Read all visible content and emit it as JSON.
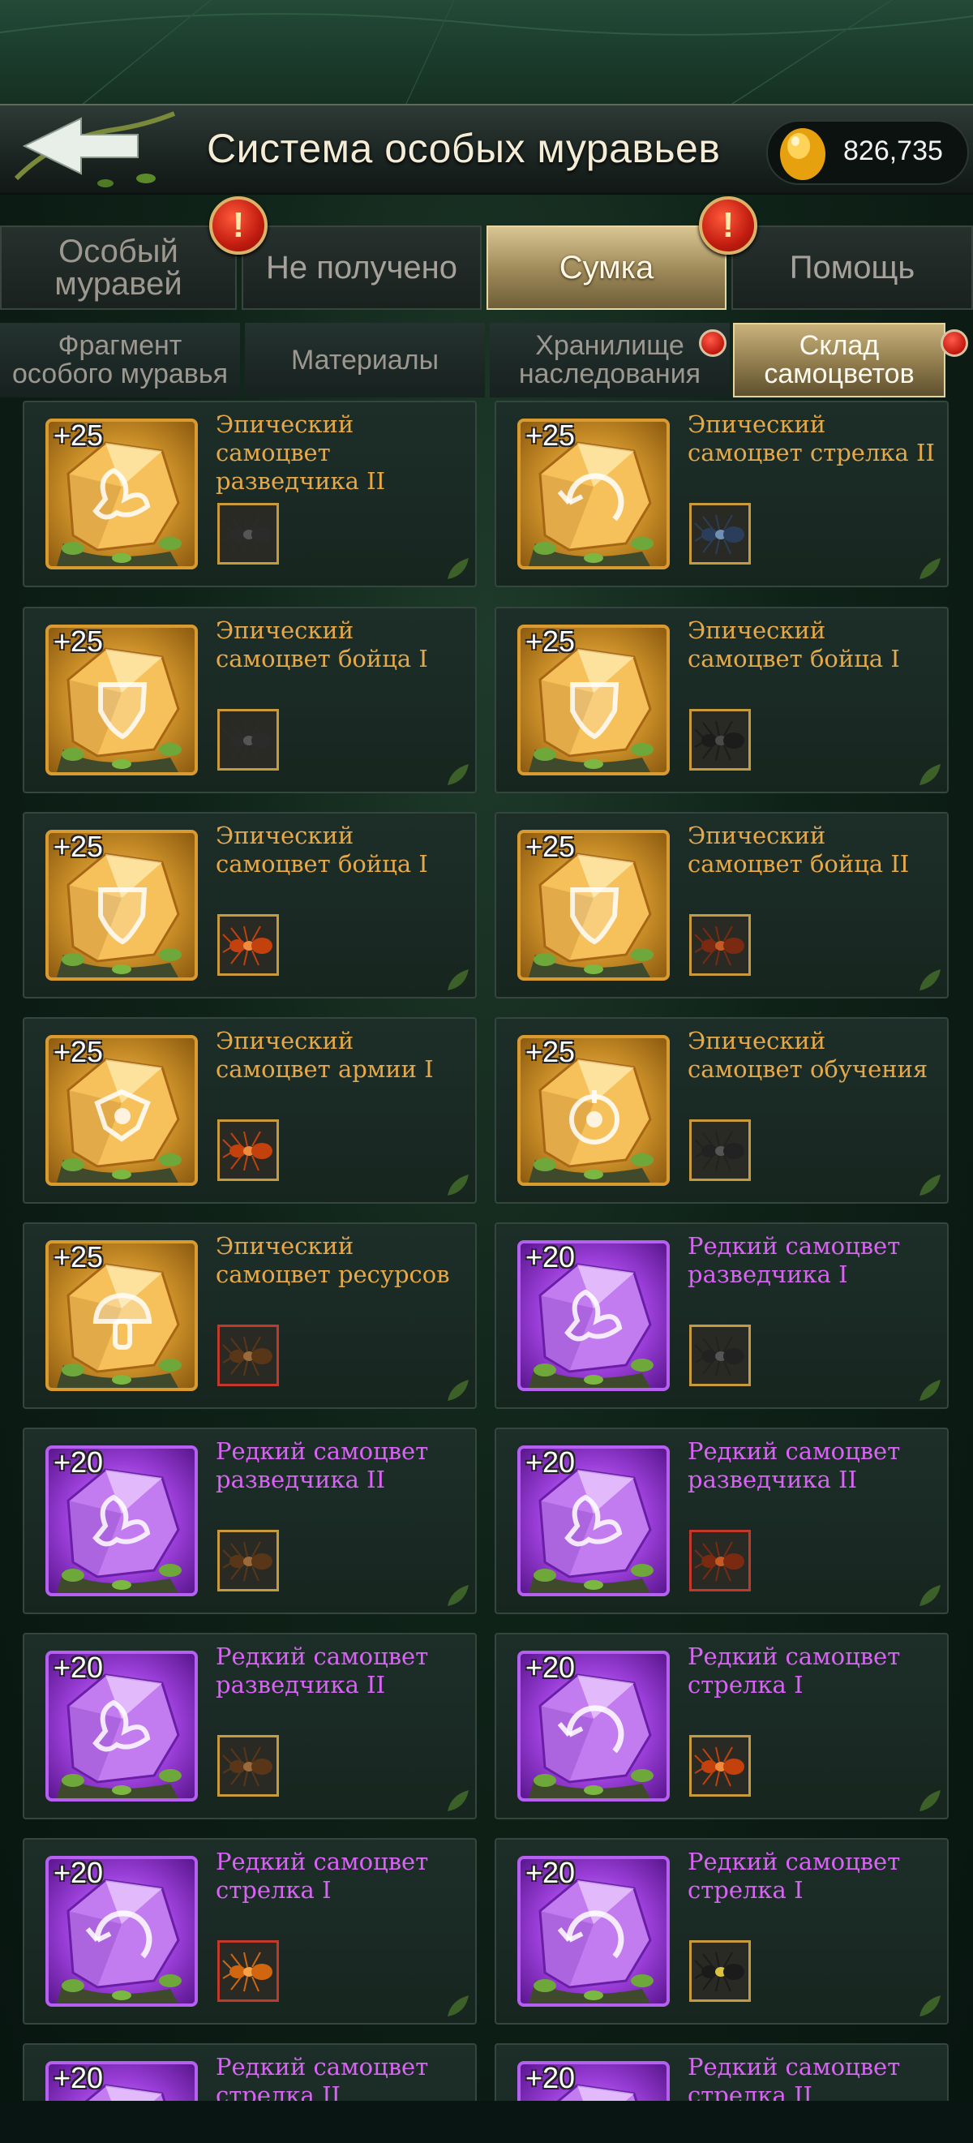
{
  "header": {
    "title": "Система особых муравьев",
    "currency_value": "826,735"
  },
  "tabs": [
    {
      "label": "Особый\nмуравей",
      "active": false,
      "alert": false
    },
    {
      "label": "Не получено",
      "active": false,
      "alert": true
    },
    {
      "label": "Сумка",
      "active": true,
      "alert": true
    },
    {
      "label": "Помощь",
      "active": false,
      "alert": false
    }
  ],
  "alert_glyph": "!",
  "subtabs": [
    {
      "label": "Фрагмент\nособого муравья",
      "active": false,
      "dot": false
    },
    {
      "label": "Материалы",
      "active": false,
      "dot": false
    },
    {
      "label": "Хранилище\nнаследования",
      "active": false,
      "dot": true
    },
    {
      "label": "Склад\nсамоцветов",
      "active": true,
      "dot": true
    }
  ],
  "gems": [
    {
      "plus": "+25",
      "rarity": "epic",
      "name": "Эпический самоцвет разведчика II",
      "symbol": "scout",
      "ant": "black-thin",
      "ant_border": "gold"
    },
    {
      "plus": "+25",
      "rarity": "epic",
      "name": "Эпический самоцвет стрелка II",
      "symbol": "archer",
      "ant": "beetle-blue",
      "ant_border": "gold"
    },
    {
      "plus": "+25",
      "rarity": "epic",
      "name": "Эпический самоцвет бойца I",
      "symbol": "shield",
      "ant": "black-thin",
      "ant_border": "gold"
    },
    {
      "plus": "+25",
      "rarity": "epic",
      "name": "Эпический самоцвет бойца I",
      "symbol": "shield",
      "ant": "beetle-black",
      "ant_border": "gold"
    },
    {
      "plus": "+25",
      "rarity": "epic",
      "name": "Эпический самоцвет бойца I",
      "symbol": "shield",
      "ant": "red-ant",
      "ant_border": "gold"
    },
    {
      "plus": "+25",
      "rarity": "epic",
      "name": "Эпический самоцвет бойца II",
      "symbol": "shield",
      "ant": "red-brown",
      "ant_border": "gold"
    },
    {
      "plus": "+25",
      "rarity": "epic",
      "name": "Эпический самоцвет армии I",
      "symbol": "army",
      "ant": "red-ant",
      "ant_border": "gold"
    },
    {
      "plus": "+25",
      "rarity": "epic",
      "name": "Эпический самоцвет обучения",
      "symbol": "training",
      "ant": "black-ant",
      "ant_border": "gold"
    },
    {
      "plus": "+25",
      "rarity": "epic",
      "name": "Эпический самоцвет ресурсов",
      "symbol": "mushroom",
      "ant": "brown-ant",
      "ant_border": "red"
    },
    {
      "plus": "+20",
      "rarity": "rare",
      "name": "Редкий самоцвет разведчика I",
      "symbol": "scout",
      "ant": "black-ant",
      "ant_border": "gold"
    },
    {
      "plus": "+20",
      "rarity": "rare",
      "name": "Редкий самоцвет разведчика II",
      "symbol": "scout",
      "ant": "brown-ant",
      "ant_border": "gold"
    },
    {
      "plus": "+20",
      "rarity": "rare",
      "name": "Редкий самоцвет разведчика II",
      "symbol": "scout",
      "ant": "red-brown",
      "ant_border": "red"
    },
    {
      "plus": "+20",
      "rarity": "rare",
      "name": "Редкий самоцвет разведчика II",
      "symbol": "scout",
      "ant": "brown-ant",
      "ant_border": "gold"
    },
    {
      "plus": "+20",
      "rarity": "rare",
      "name": "Редкий самоцвет стрелка I",
      "symbol": "archer",
      "ant": "red-ant",
      "ant_border": "gold"
    },
    {
      "plus": "+20",
      "rarity": "rare",
      "name": "Редкий самоцвет стрелка I",
      "symbol": "archer",
      "ant": "orange-ant",
      "ant_border": "red"
    },
    {
      "plus": "+20",
      "rarity": "rare",
      "name": "Редкий самоцвет стрелка I",
      "symbol": "archer",
      "ant": "yellow-black",
      "ant_border": "gold"
    },
    {
      "plus": "+20",
      "rarity": "rare",
      "name": "Редкий самоцвет стрелка II",
      "symbol": "archer",
      "ant": "black-ant",
      "ant_border": "gold"
    },
    {
      "plus": "+20",
      "rarity": "rare",
      "name": "Редкий самоцвет стрелка II",
      "symbol": "archer",
      "ant": "black-ant",
      "ant_border": "gold"
    }
  ],
  "colors": {
    "epic_text": "#e6a94a",
    "rare_text": "#d864f4",
    "active_tab": "#c9b27c"
  },
  "icons": {
    "back": "back-arrow-icon",
    "currency": "amber-gem-icon"
  }
}
